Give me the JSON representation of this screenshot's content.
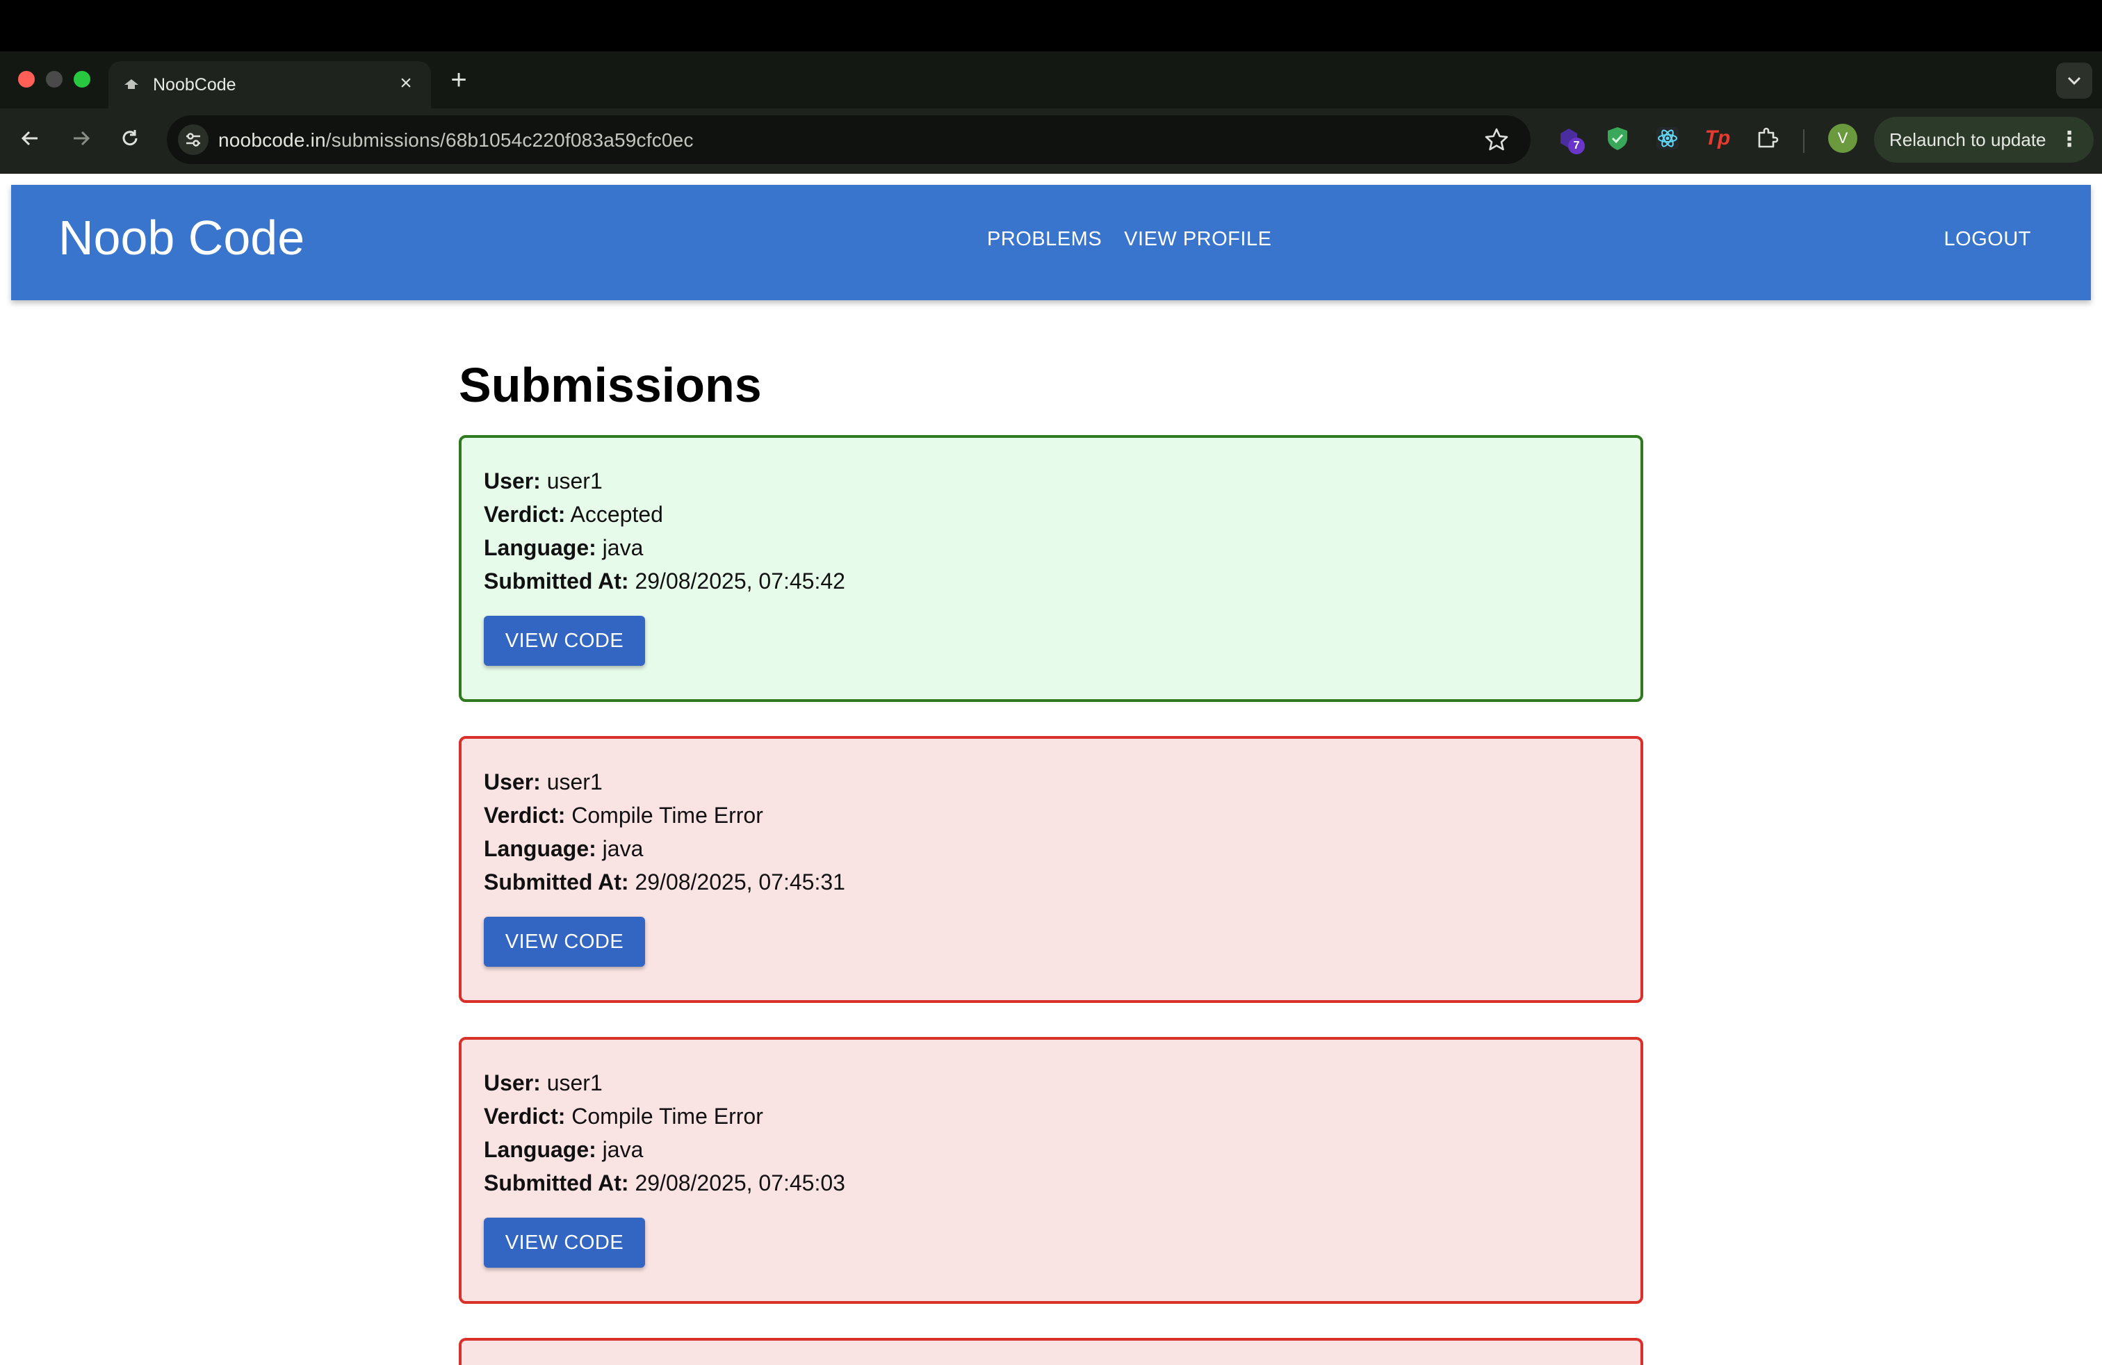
{
  "browser": {
    "tab_title": "NoobCode",
    "url_host": "noobcode.in",
    "url_path": "/submissions/68b1054c220f083a59cfc0ec",
    "extension_badge": "7",
    "avatar_initial": "V",
    "relaunch_label": "Relaunch to update",
    "extension_tp_label": "Tp",
    "icons": [
      "close-icon",
      "plus-icon",
      "chevron-down-icon",
      "back-icon",
      "forward-icon",
      "reload-icon",
      "tune-icon",
      "star-icon",
      "puzzle-icon",
      "more-vert-icon"
    ]
  },
  "header": {
    "brand": "Noob Code",
    "nav": {
      "problems": "PROBLEMS",
      "view_profile": "VIEW PROFILE"
    },
    "logout": "LOGOUT",
    "color": "#3975cc"
  },
  "main": {
    "title": "Submissions",
    "labels": {
      "user": "User:",
      "verdict": "Verdict:",
      "language": "Language:",
      "submitted_at": "Submitted At:"
    },
    "button_label": "VIEW CODE",
    "submissions": [
      {
        "user": "user1",
        "verdict": "Accepted",
        "language": "java",
        "submitted_at": "29/08/2025, 07:45:42",
        "status_color": "#2f7a1e"
      },
      {
        "user": "user1",
        "verdict": "Compile Time Error",
        "language": "java",
        "submitted_at": "29/08/2025, 07:45:31",
        "status_color": "#d9302a"
      },
      {
        "user": "user1",
        "verdict": "Compile Time Error",
        "language": "java",
        "submitted_at": "29/08/2025, 07:45:03",
        "status_color": "#d9302a"
      }
    ]
  }
}
